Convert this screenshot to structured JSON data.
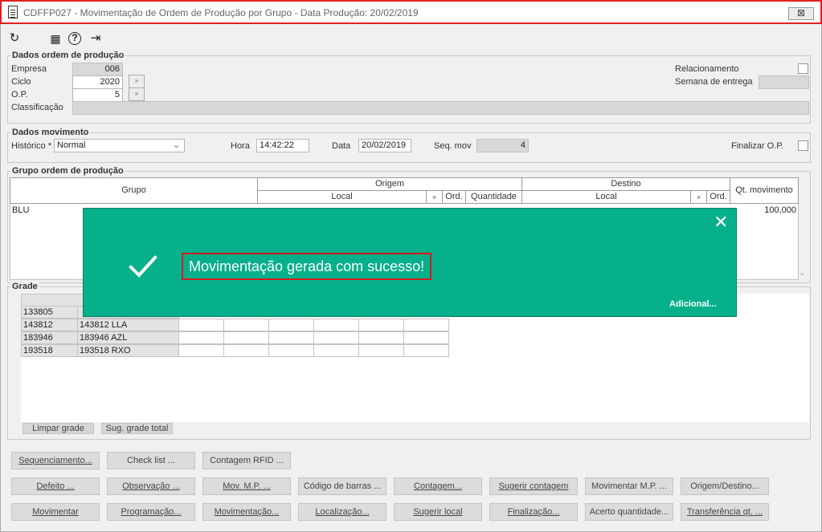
{
  "window": {
    "title": "CDFFP027 - Movimentação de Ordem de Produção por Grupo - Data Produção: 20/02/2019",
    "close": "⊠"
  },
  "toolbar": {
    "refresh_glyph": "↻",
    "calendar_glyph": "▦",
    "help_glyph": "?",
    "exit_glyph": "⇥"
  },
  "dados_ordem": {
    "legend": "Dados ordem de produção",
    "empresa_label": "Empresa",
    "empresa_value": "006",
    "ciclo_label": "Ciclo",
    "ciclo_value": "2020",
    "op_label": "O.P.",
    "op_value": "5",
    "classificacao_label": "Classificação",
    "classificacao_value": "",
    "relacionamento_label": "Relacionamento",
    "semana_label": "Semana de entrega",
    "semana_value": ""
  },
  "dados_movimento": {
    "legend": "Dados movimento",
    "historico_label": "Histórico *",
    "historico_value": "Normal",
    "hora_label": "Hora",
    "hora_value": "14:42:22",
    "data_label": "Data",
    "data_value": "20/02/2019",
    "seq_label": "Seq. mov",
    "seq_value": "4",
    "finalizar_label": "Finalizar O.P."
  },
  "grupo_ordem": {
    "legend": "Grupo ordem de produção",
    "headers": {
      "grupo": "Grupo",
      "origem": "Origem",
      "destino": "Destino",
      "qt_movimento": "Qt. movimento",
      "local": "Local",
      "ord": "Ord.",
      "quantidade": "Quantidade",
      "local2": "Local",
      "ord2": "Ord."
    },
    "row": {
      "grupo": "BLU",
      "qt_movimento": "100,000"
    }
  },
  "grade": {
    "legend": "Grade",
    "rows": [
      {
        "code": "133805",
        "desc": ""
      },
      {
        "code": "143812",
        "desc": "143812 LLA"
      },
      {
        "code": "183946",
        "desc": "183946 AZL"
      },
      {
        "code": "193518",
        "desc": "193518 RXO"
      }
    ],
    "limpar_label": "Limpar grade",
    "sug_label": "Sug. grade total"
  },
  "buttons": {
    "row1": [
      "Sequenciamento...",
      "Check list ...",
      "Contagem RFID ..."
    ],
    "row2": [
      "Defeito ...",
      "Observação ...",
      "Mov. M.P. ...",
      "Código de barras ...",
      "Contagem...",
      "Sugerir contagem",
      "Movimentar M.P. ...",
      "Origem/Destino..."
    ],
    "row3": [
      "Movimentar",
      "Programação...",
      "Movimentação...",
      "Localização...",
      "Sugerir local",
      "Finalização...",
      "Acerto quantidade...",
      "Transferência qt. ..."
    ]
  },
  "toast": {
    "message": "Movimentação gerada com sucesso!",
    "close": "✕",
    "more": "Adicional...",
    "color": "#06b08a"
  }
}
